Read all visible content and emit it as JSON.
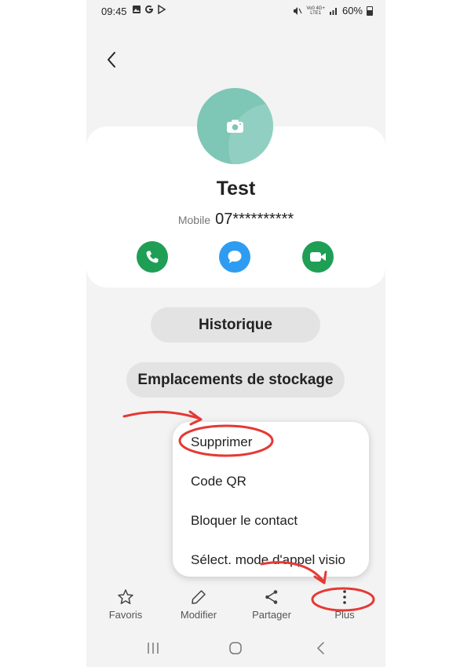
{
  "status_bar": {
    "time": "09:45",
    "network_top": "Vo0 4G+",
    "network_bottom": "LTE1",
    "battery": "60%"
  },
  "contact": {
    "name": "Test",
    "phone_label": "Mobile",
    "phone_number": "07**********"
  },
  "buttons": {
    "history": "Historique",
    "storage": "Emplacements de stockage"
  },
  "menu": {
    "items": [
      "Supprimer",
      "Code QR",
      "Bloquer le contact",
      "Sélect. mode d'appel visio"
    ]
  },
  "bottom_nav": {
    "favorites": "Favoris",
    "edit": "Modifier",
    "share": "Partager",
    "more": "Plus"
  },
  "colors": {
    "call_green": "#1f9e55",
    "message_blue": "#2d9cf2",
    "avatar_teal": "#7ec6b6",
    "annotation_red": "#e53935"
  },
  "icons": {
    "status": [
      "gallery-icon",
      "google-icon",
      "play-store-icon",
      "mute-icon",
      "signal-icon",
      "battery-icon"
    ],
    "actions": [
      "phone-icon",
      "message-icon",
      "video-icon"
    ],
    "nav": [
      "star-icon",
      "pencil-icon",
      "share-icon",
      "more-vertical-icon"
    ]
  }
}
